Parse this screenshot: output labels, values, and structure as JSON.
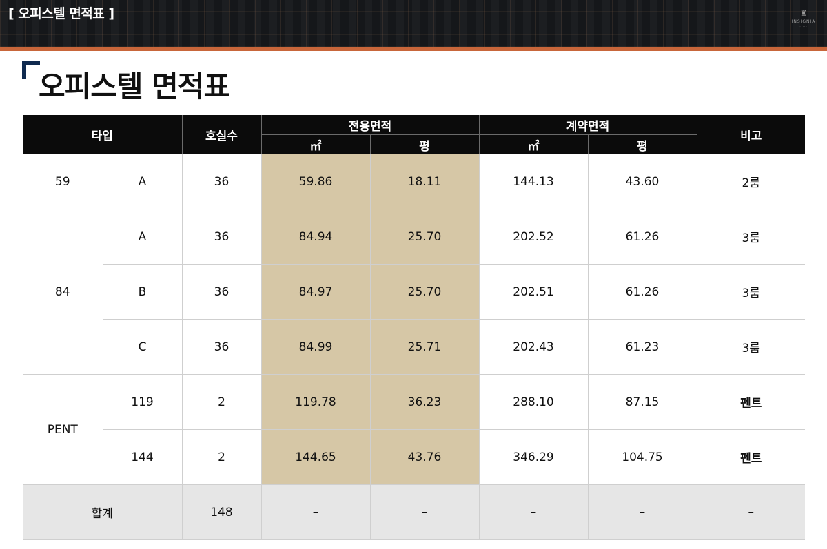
{
  "banner": {
    "title": "[ 오피스텔 면적표 ]",
    "brand_name": "INSIGNIA",
    "brand_mark": "♜",
    "brand_sub": "·····"
  },
  "colors": {
    "accent": "#c8663a",
    "corner_mark": "#0f2a4f",
    "header_bg": "#0b0b0b",
    "highlight": "#d6c7a6",
    "total_row": "#e6e6e6"
  },
  "page_title": "오피스텔 면적표",
  "table": {
    "headers": {
      "type": "타입",
      "units": "호실수",
      "exclusive_area": "전용면적",
      "contract_area": "계약면적",
      "remarks": "비고",
      "sqm": "㎡",
      "pyeong": "평"
    },
    "groups": [
      {
        "type": "59",
        "rows": [
          {
            "subtype": "A",
            "units": "36",
            "excl_sqm": "59.86",
            "excl_py": "18.11",
            "contract_sqm": "144.13",
            "contract_py": "43.60",
            "remark": "2룸"
          }
        ]
      },
      {
        "type": "84",
        "rows": [
          {
            "subtype": "A",
            "units": "36",
            "excl_sqm": "84.94",
            "excl_py": "25.70",
            "contract_sqm": "202.52",
            "contract_py": "61.26",
            "remark": "3룸"
          },
          {
            "subtype": "B",
            "units": "36",
            "excl_sqm": "84.97",
            "excl_py": "25.70",
            "contract_sqm": "202.51",
            "contract_py": "61.26",
            "remark": "3룸"
          },
          {
            "subtype": "C",
            "units": "36",
            "excl_sqm": "84.99",
            "excl_py": "25.71",
            "contract_sqm": "202.43",
            "contract_py": "61.23",
            "remark": "3룸"
          }
        ]
      },
      {
        "type": "PENT",
        "rows": [
          {
            "subtype": "119",
            "units": "2",
            "excl_sqm": "119.78",
            "excl_py": "36.23",
            "contract_sqm": "288.10",
            "contract_py": "87.15",
            "remark": "펜트"
          },
          {
            "subtype": "144",
            "units": "2",
            "excl_sqm": "144.65",
            "excl_py": "43.76",
            "contract_sqm": "346.29",
            "contract_py": "104.75",
            "remark": "펜트"
          }
        ]
      }
    ],
    "total": {
      "label": "합계",
      "units": "148",
      "excl_sqm": "–",
      "excl_py": "–",
      "contract_sqm": "–",
      "contract_py": "–",
      "remark": "–"
    }
  }
}
